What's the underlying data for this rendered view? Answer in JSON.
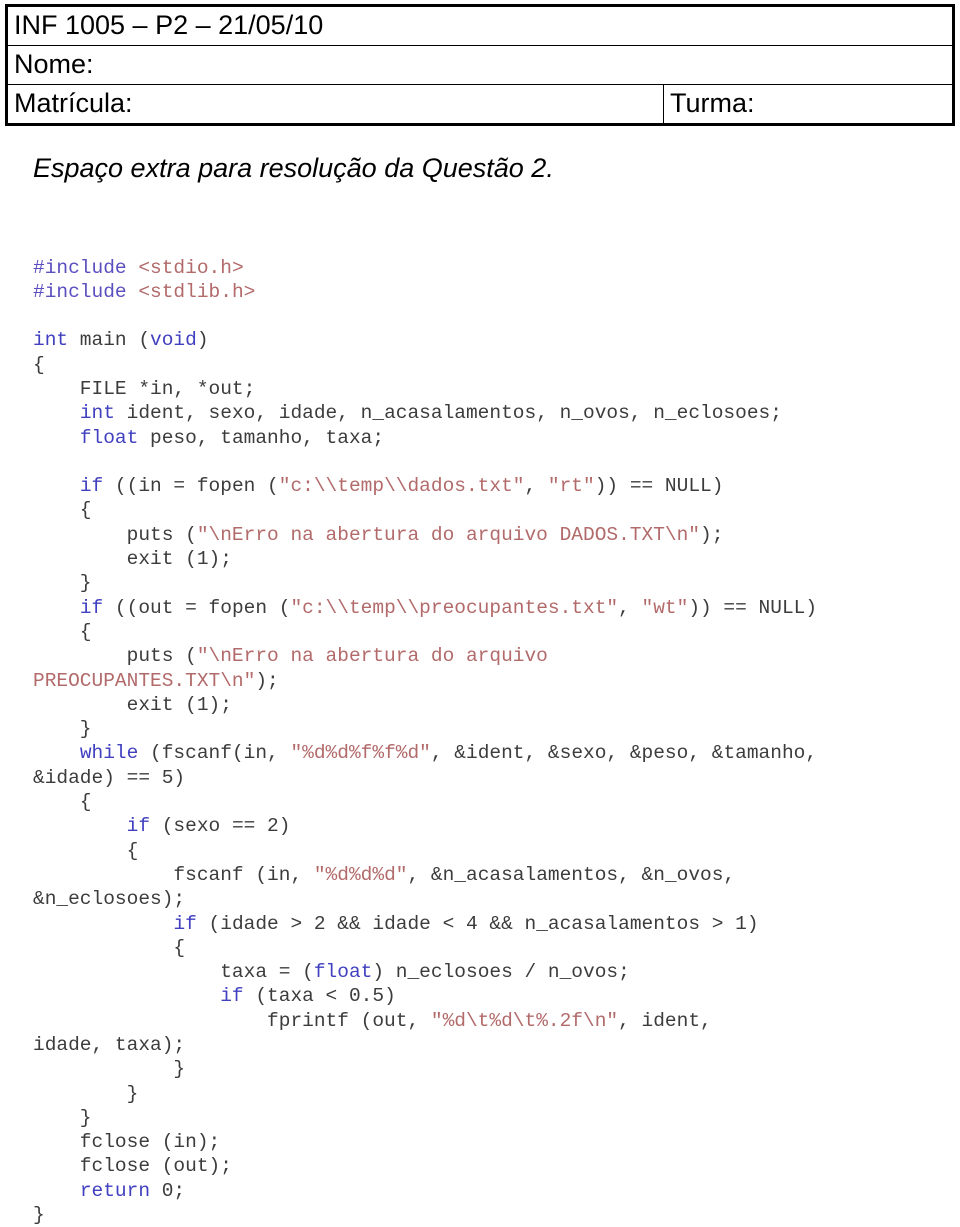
{
  "header": {
    "exam_title": "INF 1005 – P2 – 21/05/10",
    "name_label": "Nome:",
    "name_value": "",
    "registration_label": "Matrícula:",
    "registration_value": "",
    "class_label": "Turma:",
    "class_value": ""
  },
  "section": {
    "heading": "Espaço extra para resolução da Questão 2."
  },
  "colors": {
    "keyword": "#4040c0",
    "preprocessor": "#5a4fbf",
    "string": "#b26a6a",
    "plain": "#3c3c3c",
    "border": "#000000",
    "background": "#ffffff"
  },
  "code": {
    "language": "c",
    "lines": [
      [
        {
          "t": "#include ",
          "c": "pp"
        },
        {
          "t": "<stdio.h>",
          "c": "str"
        }
      ],
      [
        {
          "t": "#include ",
          "c": "pp"
        },
        {
          "t": "<stdlib.h>",
          "c": "str"
        }
      ],
      [
        {
          "t": "",
          "c": "pln"
        }
      ],
      [
        {
          "t": "int",
          "c": "kw"
        },
        {
          "t": " main (",
          "c": "pln"
        },
        {
          "t": "void",
          "c": "kw"
        },
        {
          "t": ")",
          "c": "pln"
        }
      ],
      [
        {
          "t": "{",
          "c": "pln"
        }
      ],
      [
        {
          "t": "    FILE *in, *out;",
          "c": "pln"
        }
      ],
      [
        {
          "t": "    ",
          "c": "pln"
        },
        {
          "t": "int",
          "c": "kw"
        },
        {
          "t": " ident, sexo, idade, n_acasalamentos, n_ovos, n_eclosoes;",
          "c": "pln"
        }
      ],
      [
        {
          "t": "    ",
          "c": "pln"
        },
        {
          "t": "float",
          "c": "kw"
        },
        {
          "t": " peso, tamanho, taxa;",
          "c": "pln"
        }
      ],
      [
        {
          "t": "",
          "c": "pln"
        }
      ],
      [
        {
          "t": "    ",
          "c": "pln"
        },
        {
          "t": "if",
          "c": "kw"
        },
        {
          "t": " ((in = fopen (",
          "c": "pln"
        },
        {
          "t": "\"c:\\\\temp\\\\dados.txt\"",
          "c": "str"
        },
        {
          "t": ", ",
          "c": "pln"
        },
        {
          "t": "\"rt\"",
          "c": "str"
        },
        {
          "t": ")) == NULL)",
          "c": "pln"
        }
      ],
      [
        {
          "t": "    {",
          "c": "pln"
        }
      ],
      [
        {
          "t": "        puts (",
          "c": "pln"
        },
        {
          "t": "\"\\nErro na abertura do arquivo DADOS.TXT\\n\"",
          "c": "str"
        },
        {
          "t": ");",
          "c": "pln"
        }
      ],
      [
        {
          "t": "        exit (1);",
          "c": "pln"
        }
      ],
      [
        {
          "t": "    }",
          "c": "pln"
        }
      ],
      [
        {
          "t": "    ",
          "c": "pln"
        },
        {
          "t": "if",
          "c": "kw"
        },
        {
          "t": " ((out = fopen (",
          "c": "pln"
        },
        {
          "t": "\"c:\\\\temp\\\\preocupantes.txt\"",
          "c": "str"
        },
        {
          "t": ", ",
          "c": "pln"
        },
        {
          "t": "\"wt\"",
          "c": "str"
        },
        {
          "t": ")) == NULL)",
          "c": "pln"
        }
      ],
      [
        {
          "t": "    {",
          "c": "pln"
        }
      ],
      [
        {
          "t": "        puts (",
          "c": "pln"
        },
        {
          "t": "\"\\nErro na abertura do arquivo",
          "c": "str"
        }
      ],
      [
        {
          "t": "PREOCUPANTES.TXT\\n\"",
          "c": "str"
        },
        {
          "t": ");",
          "c": "pln"
        }
      ],
      [
        {
          "t": "        exit (1);",
          "c": "pln"
        }
      ],
      [
        {
          "t": "    }",
          "c": "pln"
        }
      ],
      [
        {
          "t": "    ",
          "c": "pln"
        },
        {
          "t": "while",
          "c": "kw"
        },
        {
          "t": " (fscanf(in, ",
          "c": "pln"
        },
        {
          "t": "\"%d%d%f%f%d\"",
          "c": "str"
        },
        {
          "t": ", &ident, &sexo, &peso, &tamanho,",
          "c": "pln"
        }
      ],
      [
        {
          "t": "&idade) == 5)",
          "c": "pln"
        }
      ],
      [
        {
          "t": "    {",
          "c": "pln"
        }
      ],
      [
        {
          "t": "        ",
          "c": "pln"
        },
        {
          "t": "if",
          "c": "kw"
        },
        {
          "t": " (sexo == 2)",
          "c": "pln"
        }
      ],
      [
        {
          "t": "        {",
          "c": "pln"
        }
      ],
      [
        {
          "t": "            fscanf (in, ",
          "c": "pln"
        },
        {
          "t": "\"%d%d%d\"",
          "c": "str"
        },
        {
          "t": ", &n_acasalamentos, &n_ovos,",
          "c": "pln"
        }
      ],
      [
        {
          "t": "&n_eclosoes);",
          "c": "pln"
        }
      ],
      [
        {
          "t": "            ",
          "c": "pln"
        },
        {
          "t": "if",
          "c": "kw"
        },
        {
          "t": " (idade > 2 && idade < 4 && n_acasalamentos > 1)",
          "c": "pln"
        }
      ],
      [
        {
          "t": "            {",
          "c": "pln"
        }
      ],
      [
        {
          "t": "                taxa = (",
          "c": "pln"
        },
        {
          "t": "float",
          "c": "kw"
        },
        {
          "t": ") n_eclosoes / n_ovos;",
          "c": "pln"
        }
      ],
      [
        {
          "t": "                ",
          "c": "pln"
        },
        {
          "t": "if",
          "c": "kw"
        },
        {
          "t": " (taxa < 0.5)",
          "c": "pln"
        }
      ],
      [
        {
          "t": "                    fprintf (out, ",
          "c": "pln"
        },
        {
          "t": "\"%d\\t%d\\t%.2f\\n\"",
          "c": "str"
        },
        {
          "t": ", ident,",
          "c": "pln"
        }
      ],
      [
        {
          "t": "idade, taxa);",
          "c": "pln"
        }
      ],
      [
        {
          "t": "            }",
          "c": "pln"
        }
      ],
      [
        {
          "t": "        }",
          "c": "pln"
        }
      ],
      [
        {
          "t": "    }",
          "c": "pln"
        }
      ],
      [
        {
          "t": "    fclose (in);",
          "c": "pln"
        }
      ],
      [
        {
          "t": "    fclose (out);",
          "c": "pln"
        }
      ],
      [
        {
          "t": "    ",
          "c": "pln"
        },
        {
          "t": "return",
          "c": "kw"
        },
        {
          "t": " 0;",
          "c": "pln"
        }
      ],
      [
        {
          "t": "}",
          "c": "pln"
        }
      ]
    ]
  }
}
